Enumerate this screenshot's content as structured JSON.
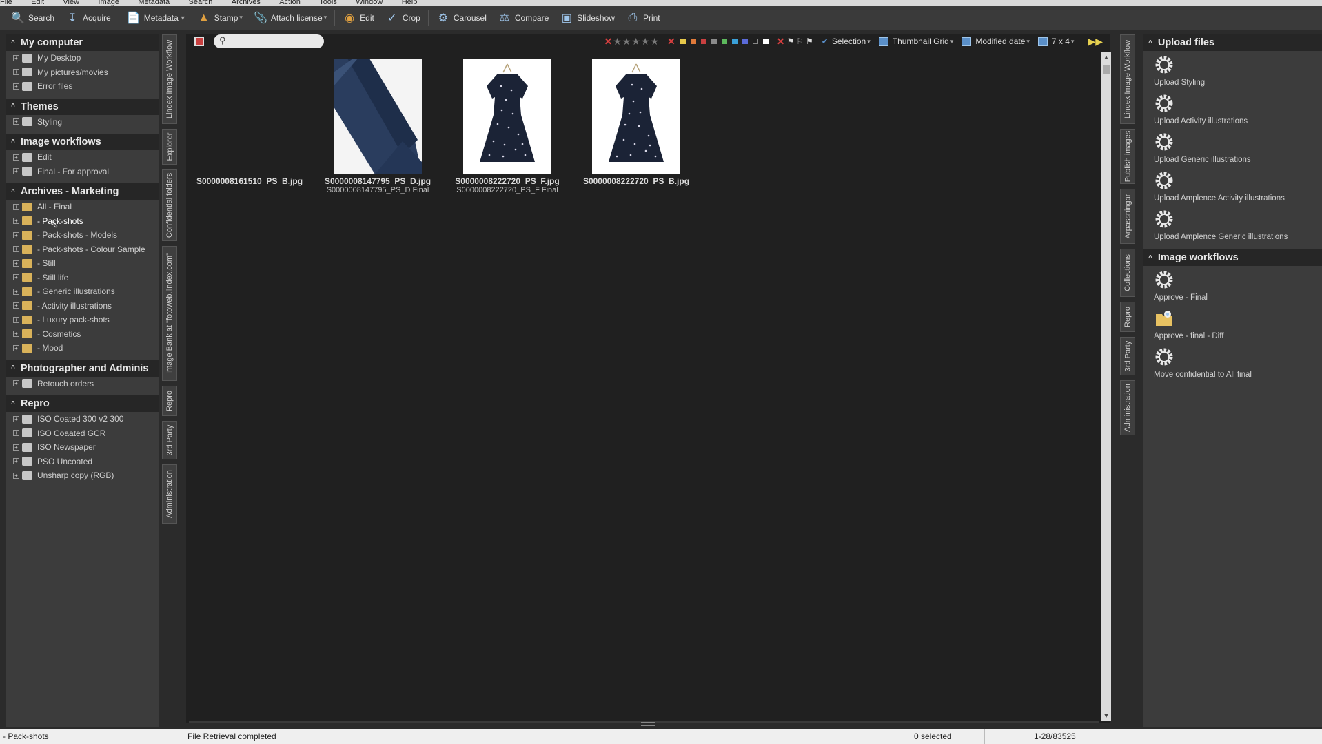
{
  "menu": [
    "File",
    "Edit",
    "View",
    "Image",
    "Metadata",
    "Search",
    "Archives",
    "Action",
    "Tools",
    "Window",
    "Help"
  ],
  "toolbar": {
    "search": "Search",
    "acquire": "Acquire",
    "metadata": "Metadata",
    "stamp": "Stamp",
    "attach_license": "Attach license",
    "edit": "Edit",
    "crop": "Crop",
    "carousel": "Carousel",
    "compare": "Compare",
    "slideshow": "Slideshow",
    "print": "Print"
  },
  "left": {
    "my_computer": {
      "title": "My computer",
      "items": [
        "My Desktop",
        "My pictures/movies",
        "Error files"
      ]
    },
    "themes": {
      "title": "Themes",
      "items": [
        "Styling"
      ]
    },
    "image_workflows": {
      "title": "Image workflows",
      "items": [
        "Edit",
        "Final - For approval"
      ]
    },
    "archives": {
      "title": "Archives - Marketing",
      "items": [
        "All - Final",
        "- Pack-shots",
        "- Pack-shots - Models",
        "- Pack-shots - Colour Sample",
        "- Still",
        "- Still life",
        "- Generic illustrations",
        "- Activity illustrations",
        "- Luxury pack-shots",
        "- Cosmetics",
        "- Mood"
      ]
    },
    "photographer": {
      "title": "Photographer and Adminis",
      "items": [
        "Retouch orders"
      ]
    },
    "repro": {
      "title": "Repro",
      "items": [
        "ISO Coated 300 v2 300",
        "ISO Coaated GCR",
        "ISO Newspaper",
        "PSO Uncoated",
        "Unsharp copy (RGB)"
      ]
    }
  },
  "left_vtabs": [
    "Lindex Image Workflow",
    "Explorer",
    "Confidential folders",
    "Image Bank at \"fotoweb.lindex.com\"",
    "Repro",
    "3rd Party",
    "Administration"
  ],
  "right_vtabs": [
    "Lindex Image Workflow",
    "Publish images",
    "Arpassningar",
    "Collections",
    "Repro",
    "3rd Party",
    "Administration"
  ],
  "viewbar": {
    "selection": "Selection",
    "thumbnail_grid": "Thumbnail Grid",
    "modified_date": "Modified date",
    "grid_size": "7 x 4"
  },
  "colors": {
    "swatches": [
      "#e6c84a",
      "#e07a3a",
      "#c94040",
      "#8a8a8a",
      "#5cb85c",
      "#3aa0d8",
      "#5a6ad8",
      "#1e1e1e",
      "#ffffff"
    ]
  },
  "thumbnails": [
    {
      "name": "S0000008161510_PS_B.jpg",
      "sub": ""
    },
    {
      "name": "S0000008147795_PS_D.jpg",
      "sub": "S0000008147795_PS_D Final"
    },
    {
      "name": "S0000008222720_PS_F.jpg",
      "sub": "S0000008222720_PS_F Final"
    },
    {
      "name": "S0000008222720_PS_B.jpg",
      "sub": ""
    }
  ],
  "right": {
    "upload": {
      "title": "Upload files",
      "items": [
        "Upload Styling",
        "Upload Activity illustrations",
        "Upload Generic illustrations",
        "Upload Amplence Activity illustrations",
        "Upload Amplence Generic illustrations"
      ]
    },
    "workflows": {
      "title": "Image workflows",
      "items": [
        "Approve - Final",
        "Approve - final - Diff",
        "Move confidential to All final"
      ]
    }
  },
  "status": {
    "folder": "- Pack-shots",
    "message": "File Retrieval completed",
    "selected": "0 selected",
    "range": "1-28/83525"
  }
}
